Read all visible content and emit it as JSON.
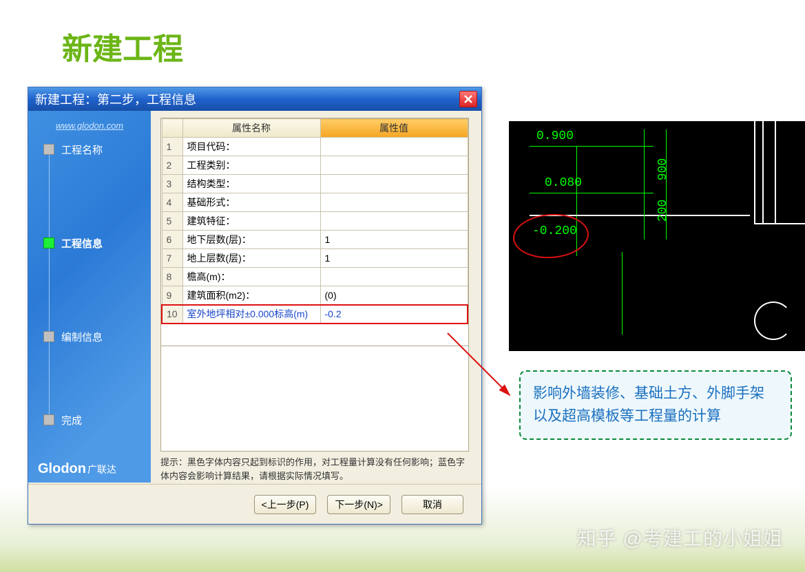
{
  "slide_title": "新建工程",
  "dialog": {
    "title": "新建工程：第二步，工程信息",
    "sidebar": {
      "url": "www.glodon.com",
      "steps": [
        {
          "label": "工程名称",
          "active": false
        },
        {
          "label": "工程信息",
          "active": true
        },
        {
          "label": "编制信息",
          "active": false
        },
        {
          "label": "完成",
          "active": false
        }
      ],
      "brand": "Glodon",
      "brand_cn": "广联达"
    },
    "grid": {
      "head_name": "属性名称",
      "head_value": "属性值",
      "rows": [
        {
          "n": "1",
          "name": "项目代码：",
          "value": ""
        },
        {
          "n": "2",
          "name": "工程类别：",
          "value": ""
        },
        {
          "n": "3",
          "name": "结构类型：",
          "value": ""
        },
        {
          "n": "4",
          "name": "基础形式：",
          "value": ""
        },
        {
          "n": "5",
          "name": "建筑特征：",
          "value": ""
        },
        {
          "n": "6",
          "name": "地下层数(层)：",
          "value": "1"
        },
        {
          "n": "7",
          "name": "地上层数(层)：",
          "value": "1"
        },
        {
          "n": "8",
          "name": "檐高(m)：",
          "value": ""
        },
        {
          "n": "9",
          "name": "建筑面积(m2)：",
          "value": "(0)"
        },
        {
          "n": "10",
          "name": "室外地坪相对±0.000标高(m)",
          "value": "-0.2"
        }
      ]
    },
    "hint": "提示：黑色字体内容只起到标识的作用，对工程量计算没有任何影响；蓝色字体内容会影响计算结果，请根据实际情况填写。",
    "buttons": {
      "prev": "<上一步(P)",
      "next": "下一步(N)>",
      "cancel": "取消"
    }
  },
  "cad": {
    "labels": {
      "a": "0.900",
      "b": "0.080",
      "c": "-0.200",
      "d": "900",
      "e": "200"
    }
  },
  "callout": "影响外墙装修、基础土方、外脚手架以及超高模板等工程量的计算",
  "watermark": "知乎 @考建工的小姐姐"
}
